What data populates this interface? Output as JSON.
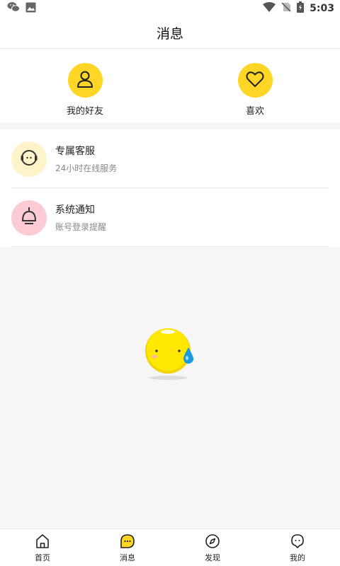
{
  "status_bar": {
    "time": "5:03",
    "left_icons": [
      "wechat-icon",
      "image-icon"
    ],
    "right_icons": [
      "wifi-icon",
      "no-sim-icon",
      "battery-charging-icon"
    ]
  },
  "header": {
    "title": "消息"
  },
  "quick": [
    {
      "label": "我的好友",
      "icon": "user-icon"
    },
    {
      "label": "喜欢",
      "icon": "heart-icon"
    }
  ],
  "list": [
    {
      "title": "专属客服",
      "subtitle": "24小时在线服务",
      "icon": "customer-service-icon",
      "color": "#fff3c9"
    },
    {
      "title": "系统通知",
      "subtitle": "账号登录提醒",
      "icon": "bell-icon",
      "color": "#fccbd4"
    }
  ],
  "empty_state": {
    "icon": "sweating-emoji-icon"
  },
  "tabs": [
    {
      "label": "首页",
      "icon": "home-icon",
      "active": false
    },
    {
      "label": "消息",
      "icon": "message-icon",
      "active": true
    },
    {
      "label": "发现",
      "icon": "compass-icon",
      "active": false
    },
    {
      "label": "我的",
      "icon": "profile-icon",
      "active": false
    }
  ],
  "colors": {
    "accent": "#ffd626",
    "background": "#f6f6f6"
  }
}
